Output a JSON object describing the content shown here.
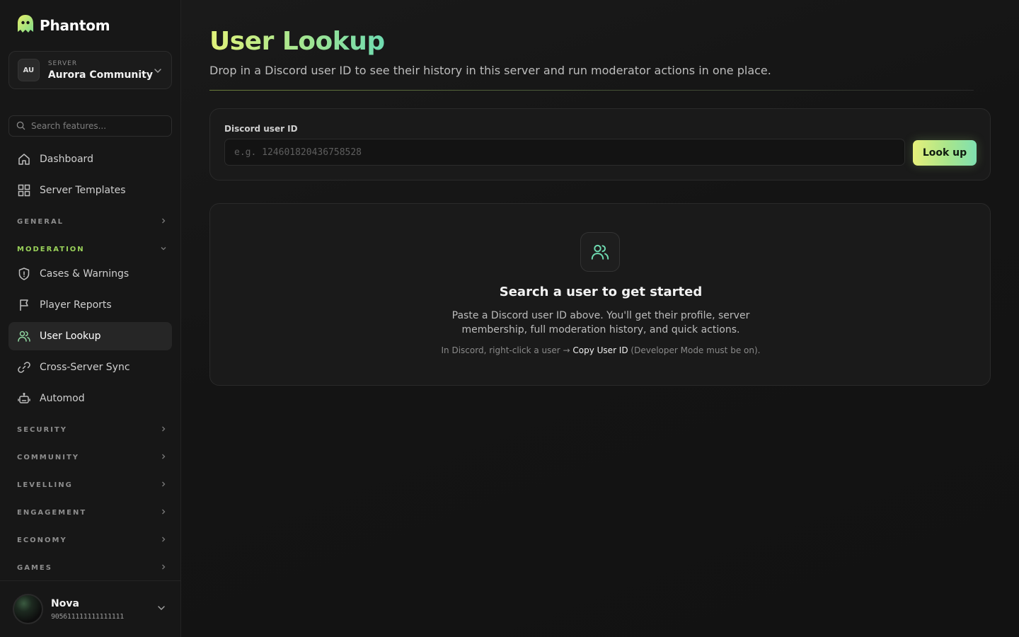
{
  "brand": {
    "name": "Phantom"
  },
  "server": {
    "label": "SERVER",
    "initials": "AU",
    "name": "Aurora Community"
  },
  "search": {
    "placeholder": "Search features..."
  },
  "nav": {
    "dashboard": "Dashboard",
    "templates": "Server Templates",
    "sections": {
      "general": "GENERAL",
      "moderation": "MODERATION",
      "security": "SECURITY",
      "community": "COMMUNITY",
      "levelling": "LEVELLING",
      "engagement": "ENGAGEMENT",
      "economy": "ECONOMY",
      "games": "GAMES"
    },
    "moderation_items": {
      "cases": "Cases & Warnings",
      "reports": "Player Reports",
      "lookup": "User Lookup",
      "sync": "Cross-Server Sync",
      "automod": "Automod"
    }
  },
  "user": {
    "name": "Nova",
    "id": "905611111111111111"
  },
  "page": {
    "title": "User Lookup",
    "subtitle": "Drop in a Discord user ID to see their history in this server and run moderator actions in one place.",
    "input_label": "Discord user ID",
    "input_placeholder": "e.g. 124601820436758528",
    "button": "Look up",
    "empty_title": "Search a user to get started",
    "empty_desc": "Paste a Discord user ID above. You'll get their profile, server membership, full moderation history, and quick actions.",
    "hint_pre": "In Discord, right-click a user → ",
    "hint_strong": "Copy User ID",
    "hint_post": " (Developer Mode must be on)."
  },
  "colors": {
    "accent": "#9ad25a",
    "accent_teal": "#6fdbb1",
    "accent_yellow": "#e2f27a"
  }
}
